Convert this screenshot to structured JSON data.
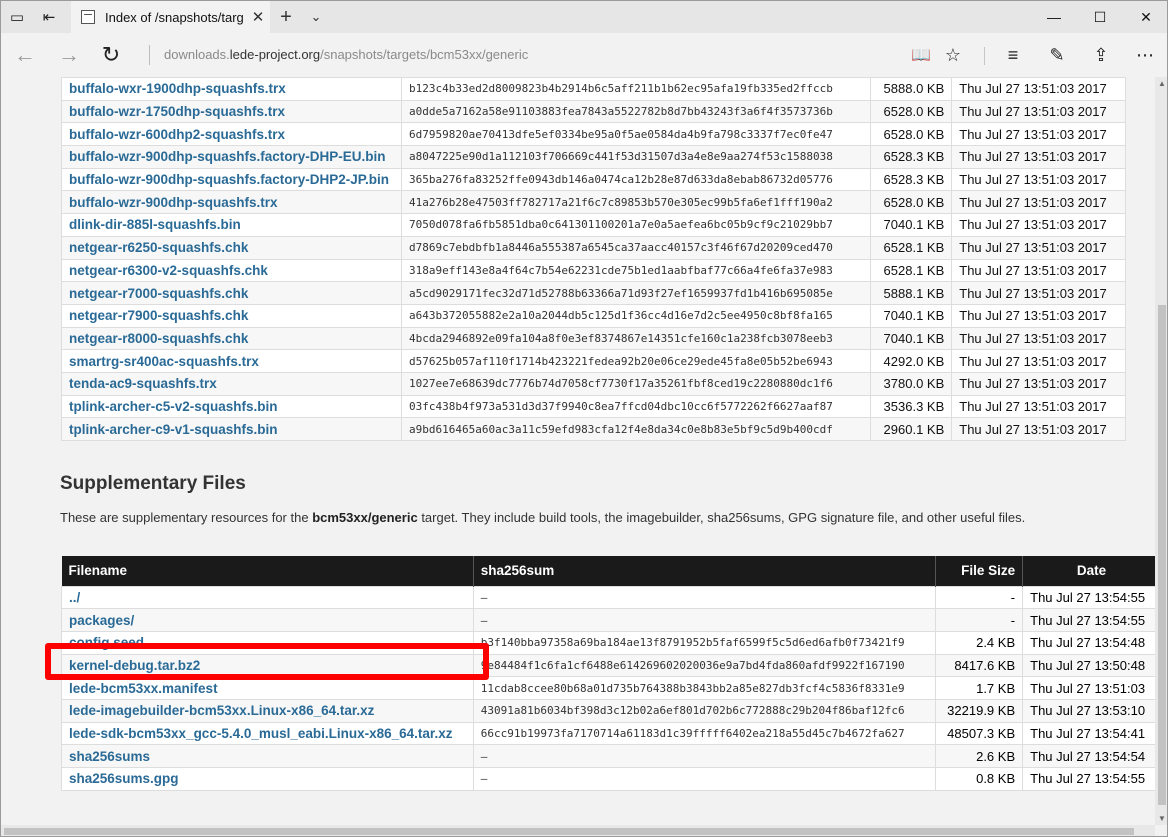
{
  "browser": {
    "tab_title": "Index of /snapshots/targ",
    "url_prefix": "downloads.",
    "url_host": "lede-project.org",
    "url_path": "/snapshots/targets/bcm53xx/generic"
  },
  "icons": {
    "tabs_aside": "▭",
    "set_aside": "⇤",
    "tab_close": "✕",
    "new_tab": "+",
    "tab_list": "⌄",
    "minimize": "—",
    "maximize": "☐",
    "close": "✕",
    "back": "←",
    "forward": "→",
    "refresh": "↻",
    "reading_view": "📖",
    "favorite": "☆",
    "hub": "≡",
    "notes": "✎",
    "share": "⇪",
    "more": "⋯"
  },
  "main_files": [
    {
      "name": "buffalo-wxr-1900dhp-squashfs.trx",
      "sha": "b123c4b33ed2d8009823b4b2914b6c5aff211b1b62ec95afa19fb335ed2ffccb",
      "size": "5888.0 KB",
      "date": "Thu Jul 27 13:51:03 2017"
    },
    {
      "name": "buffalo-wzr-1750dhp-squashfs.trx",
      "sha": "a0dde5a7162a58e91103883fea7843a5522782b8d7bb43243f3a6f4f3573736b",
      "size": "6528.0 KB",
      "date": "Thu Jul 27 13:51:03 2017"
    },
    {
      "name": "buffalo-wzr-600dhp2-squashfs.trx",
      "sha": "6d7959820ae70413dfe5ef0334be95a0f5ae0584da4b9fa798c3337f7ec0fe47",
      "size": "6528.0 KB",
      "date": "Thu Jul 27 13:51:03 2017"
    },
    {
      "name": "buffalo-wzr-900dhp-squashfs.factory-DHP-EU.bin",
      "sha": "a8047225e90d1a112103f706669c441f53d31507d3a4e8e9aa274f53c1588038",
      "size": "6528.3 KB",
      "date": "Thu Jul 27 13:51:03 2017"
    },
    {
      "name": "buffalo-wzr-900dhp-squashfs.factory-DHP2-JP.bin",
      "sha": "365ba276fa83252ffe0943db146a0474ca12b28e87d633da8ebab86732d05776",
      "size": "6528.3 KB",
      "date": "Thu Jul 27 13:51:03 2017"
    },
    {
      "name": "buffalo-wzr-900dhp-squashfs.trx",
      "sha": "41a276b28e47503ff782717a21f6c7c89853b570e305ec99b5fa6ef1fff190a2",
      "size": "6528.0 KB",
      "date": "Thu Jul 27 13:51:03 2017"
    },
    {
      "name": "dlink-dir-885l-squashfs.bin",
      "sha": "7050d078fa6fb5851dba0c641301100201a7e0a5aefea6bc05b9cf9c21029bb7",
      "size": "7040.1 KB",
      "date": "Thu Jul 27 13:51:03 2017"
    },
    {
      "name": "netgear-r6250-squashfs.chk",
      "sha": "d7869c7ebdbfb1a8446a555387a6545ca37aacc40157c3f46f67d20209ced470",
      "size": "6528.1 KB",
      "date": "Thu Jul 27 13:51:03 2017"
    },
    {
      "name": "netgear-r6300-v2-squashfs.chk",
      "sha": "318a9eff143e8a4f64c7b54e62231cde75b1ed1aabfbaf77c66a4fe6fa37e983",
      "size": "6528.1 KB",
      "date": "Thu Jul 27 13:51:03 2017"
    },
    {
      "name": "netgear-r7000-squashfs.chk",
      "sha": "a5cd9029171fec32d71d52788b63366a71d93f27ef1659937fd1b416b695085e",
      "size": "5888.1 KB",
      "date": "Thu Jul 27 13:51:03 2017"
    },
    {
      "name": "netgear-r7900-squashfs.chk",
      "sha": "a643b372055882e2a10a2044db5c125d1f36cc4d16e7d2c5ee4950c8bf8fa165",
      "size": "7040.1 KB",
      "date": "Thu Jul 27 13:51:03 2017"
    },
    {
      "name": "netgear-r8000-squashfs.chk",
      "sha": "4bcda2946892e09fa104a8f0e3ef8374867e14351cfe160c1a238fcb3078eeb3",
      "size": "7040.1 KB",
      "date": "Thu Jul 27 13:51:03 2017"
    },
    {
      "name": "smartrg-sr400ac-squashfs.trx",
      "sha": "d57625b057af110f1714b423221fedea92b20e06ce29ede45fa8e05b52be6943",
      "size": "4292.0 KB",
      "date": "Thu Jul 27 13:51:03 2017"
    },
    {
      "name": "tenda-ac9-squashfs.trx",
      "sha": "1027ee7e68639dc7776b74d7058cf7730f17a35261fbf8ced19c2280880dc1f6",
      "size": "3780.0 KB",
      "date": "Thu Jul 27 13:51:03 2017"
    },
    {
      "name": "tplink-archer-c5-v2-squashfs.bin",
      "sha": "03fc438b4f973a531d3d37f9940c8ea7ffcd04dbc10cc6f5772262f6627aaf87",
      "size": "3536.3 KB",
      "date": "Thu Jul 27 13:51:03 2017"
    },
    {
      "name": "tplink-archer-c9-v1-squashfs.bin",
      "sha": "a9bd616465a60ac3a11c59efd983cfa12f4e8da34c0e8b83e5bf9c5d9b400cdf",
      "size": "2960.1 KB",
      "date": "Thu Jul 27 13:51:03 2017"
    }
  ],
  "supplementary": {
    "heading": "Supplementary Files",
    "desc_before": "These are supplementary resources for the ",
    "desc_target": "bcm53xx/generic",
    "desc_after": " target. They include build tools, the imagebuilder, sha256sums, GPG signature file, and other useful files.",
    "headers": {
      "filename": "Filename",
      "sha": "sha256sum",
      "size": "File Size",
      "date": "Date"
    },
    "files": [
      {
        "name": "../",
        "sha": "–",
        "size": "-",
        "date": "Thu Jul 27 13:54:55"
      },
      {
        "name": "packages/",
        "sha": "–",
        "size": "-",
        "date": "Thu Jul 27 13:54:55"
      },
      {
        "name": "config.seed",
        "sha": "b3f140bba97358a69ba184ae13f8791952b5faf6599f5c5d6ed6afb0f73421f9",
        "size": "2.4 KB",
        "date": "Thu Jul 27 13:54:48"
      },
      {
        "name": "kernel-debug.tar.bz2",
        "sha": "9e84484f1c6fa1cf6488e614269602020036e9a7bd4fda860afdf9922f167190",
        "size": "8417.6 KB",
        "date": "Thu Jul 27 13:50:48"
      },
      {
        "name": "lede-bcm53xx.manifest",
        "sha": "11cdab8ccee80b68a01d735b764388b3843bb2a85e827db3fcf4c5836f8331e9",
        "size": "1.7 KB",
        "date": "Thu Jul 27 13:51:03"
      },
      {
        "name": "lede-imagebuilder-bcm53xx.Linux-x86_64.tar.xz",
        "sha": "43091a81b6034bf398d3c12b02a6ef801d702b6c772888c29b204f86baf12fc6",
        "size": "32219.9 KB",
        "date": "Thu Jul 27 13:53:10"
      },
      {
        "name": "lede-sdk-bcm53xx_gcc-5.4.0_musl_eabi.Linux-x86_64.tar.xz",
        "sha": "66cc91b19973fa7170714a61183d1c39fffff6402ea218a55d45c7b4672fa627",
        "size": "48507.3 KB",
        "date": "Thu Jul 27 13:54:41"
      },
      {
        "name": "sha256sums",
        "sha": "–",
        "size": "2.6 KB",
        "date": "Thu Jul 27 13:54:54"
      },
      {
        "name": "sha256sums.gpg",
        "sha": "–",
        "size": "0.8 KB",
        "date": "Thu Jul 27 13:54:55"
      }
    ]
  },
  "highlight_color": "#ff0000"
}
